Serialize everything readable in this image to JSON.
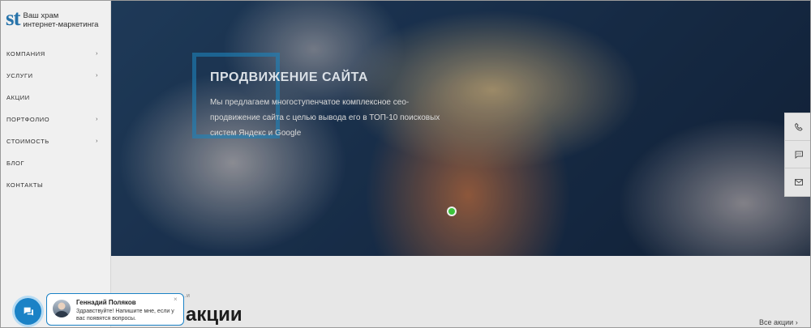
{
  "logo": {
    "mark": "st",
    "line1": "Ваш храм",
    "line2": "интернет-маркетинга"
  },
  "nav": {
    "items": [
      {
        "label": "КОМПАНИЯ",
        "arrow": "›"
      },
      {
        "label": "УСЛУГИ",
        "arrow": "›"
      },
      {
        "label": "АКЦИИ",
        "arrow": ""
      },
      {
        "label": "ПОРТФОЛИО",
        "arrow": "›"
      },
      {
        "label": "СТОИМОСТЬ",
        "arrow": "›"
      },
      {
        "label": "БЛОГ",
        "arrow": ""
      },
      {
        "label": "КОНТАКТЫ",
        "arrow": ""
      }
    ]
  },
  "hero": {
    "title": "ПРОДВИЖЕНИЕ САЙТА",
    "description": "Мы предлагаем многоступенчатое комплексное сео-продвижение сайта с целью вывода его в ТОП-10 поисковых систем Яндекс и Google"
  },
  "rail": {
    "icons": [
      "phone-icon",
      "chat-icon",
      "mail-icon"
    ]
  },
  "section": {
    "breadcrumb": "…и",
    "title": "акции",
    "all_link": "Все акции",
    "all_arrow": "›"
  },
  "chat": {
    "name": "Геннадий Поляков",
    "message": "Здравствуйте! Напишите мне, если у вас появятся вопросы.",
    "close": "×"
  },
  "colors": {
    "accent": "#1b82c6",
    "brand": "#2a7bb5"
  }
}
